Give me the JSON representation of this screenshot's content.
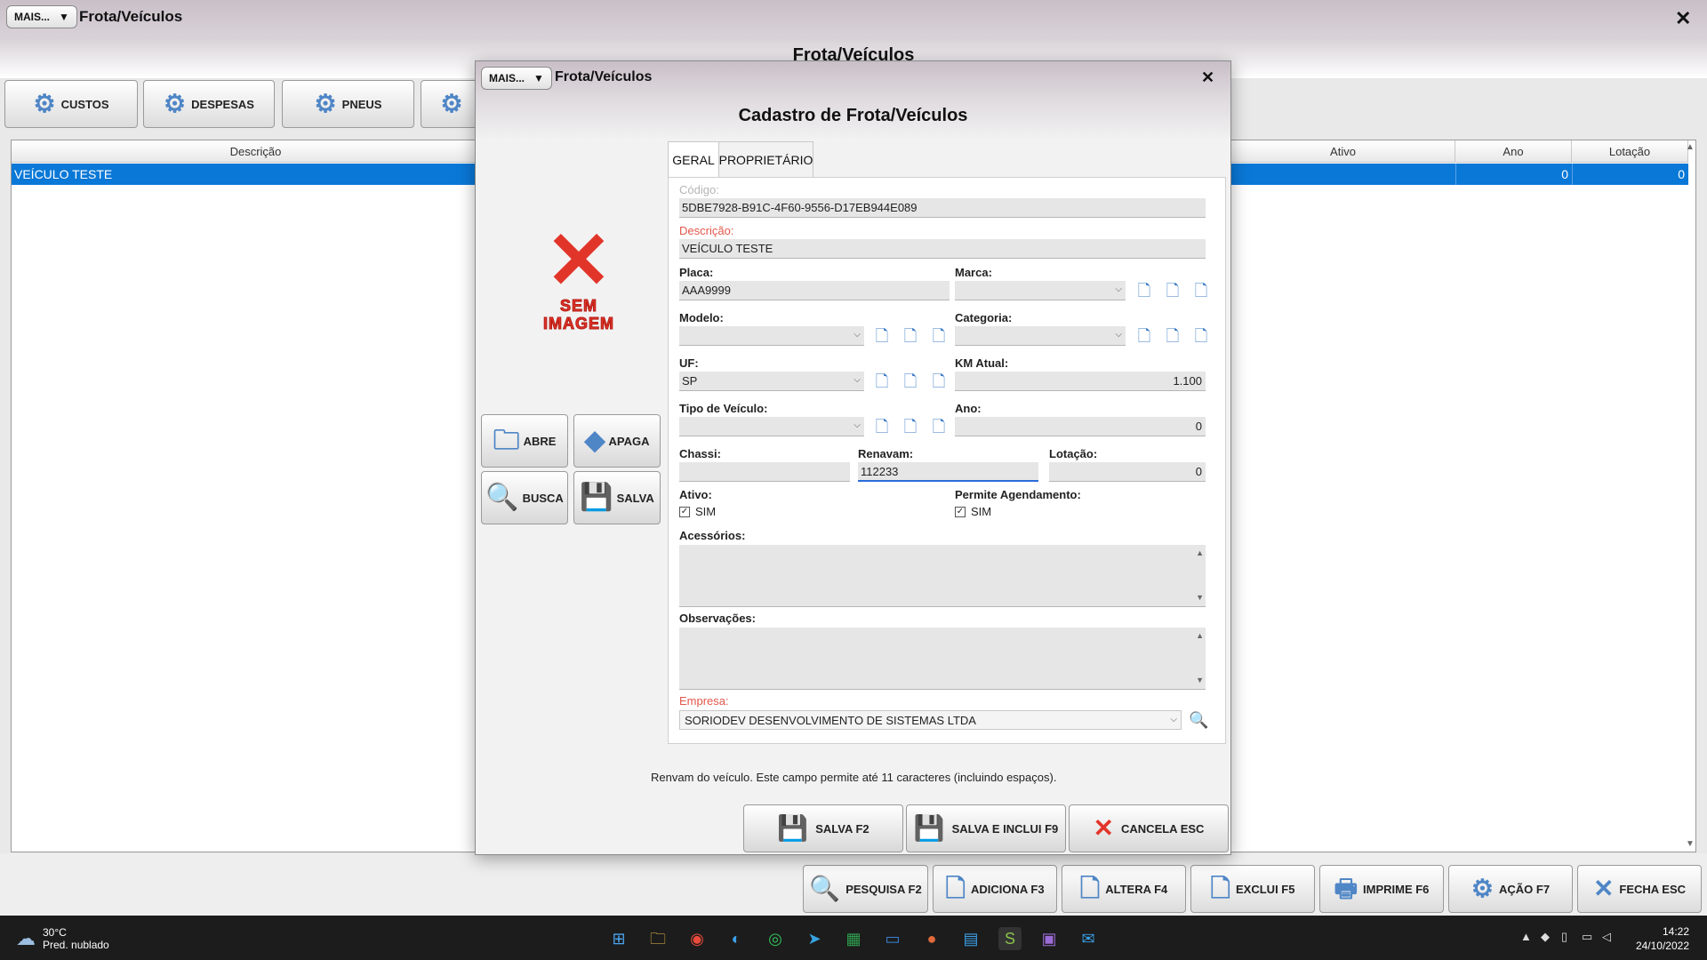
{
  "main": {
    "mais_label": "MAIS...",
    "window_title": "Frota/Veículos",
    "center_title": "Frota/Veículos",
    "close_glyph": "✕",
    "top_buttons": [
      "CUSTOS",
      "DESPESAS",
      "PNEUS"
    ],
    "grid": {
      "columns": [
        "Descrição",
        "Ativo",
        "Ano",
        "Lotação"
      ],
      "row": {
        "descricao": "VEÍCULO TESTE",
        "ano": "0",
        "lotacao": "0"
      }
    },
    "bottom_buttons": [
      "PESQUISA F2",
      "ADICIONA F3",
      "ALTERA F4",
      "EXCLUI F5",
      "IMPRIME F6",
      "AÇÃO F7",
      "FECHA ESC"
    ]
  },
  "modal": {
    "mais_label": "MAIS...",
    "window_title": "Frota/Veículos",
    "heading": "Cadastro de Frota/Veículos",
    "close_glyph": "✕",
    "no_image_text": [
      "SEM",
      "IMAGEM"
    ],
    "side_buttons": {
      "abre": "ABRE",
      "apaga": "APAGA",
      "busca": "BUSCA",
      "salva": "SALVA"
    },
    "tabs": [
      "GERAL",
      "PROPRIETÁRIO"
    ],
    "active_tab": "GERAL",
    "fields": {
      "codigo_label": "Código:",
      "codigo_value": "5DBE7928-B91C-4F60-9556-D17EB944E089",
      "descricao_label": "Descrição:",
      "descricao_value": "VEÍCULO TESTE",
      "placa_label": "Placa:",
      "placa_value": "AAA9999",
      "marca_label": "Marca:",
      "marca_value": "",
      "modelo_label": "Modelo:",
      "modelo_value": "",
      "categoria_label": "Categoria:",
      "categoria_value": "",
      "uf_label": "UF:",
      "uf_value": "SP",
      "km_label": "KM Atual:",
      "km_value": "1.100",
      "tipo_label": "Tipo de Veículo:",
      "tipo_value": "",
      "ano_label": "Ano:",
      "ano_value": "0",
      "chassi_label": "Chassi:",
      "chassi_value": "",
      "renavam_label": "Renavam:",
      "renavam_value": "112233",
      "lotacao_label": "Lotação:",
      "lotacao_value": "0",
      "ativo_label": "Ativo:",
      "ativo_check": "SIM",
      "agendamento_label": "Permite Agendamento:",
      "agendamento_check": "SIM",
      "acessorios_label": "Acessórios:",
      "observacoes_label": "Observações:",
      "empresa_label": "Empresa:",
      "empresa_value": "SORIODEV DESENVOLVIMENTO DE SISTEMAS LTDA"
    },
    "help_text": "Renvam do veículo. Este campo permite até 11 caracteres (incluindo espaços).",
    "buttons": {
      "salva": "SALVA F2",
      "salva_inclui": "SALVA E INCLUI F9",
      "cancela": "CANCELA ESC"
    }
  },
  "taskbar": {
    "temperature": "30°C",
    "weather": "Pred. nublado",
    "time": "14:22",
    "date": "24/10/2022"
  }
}
